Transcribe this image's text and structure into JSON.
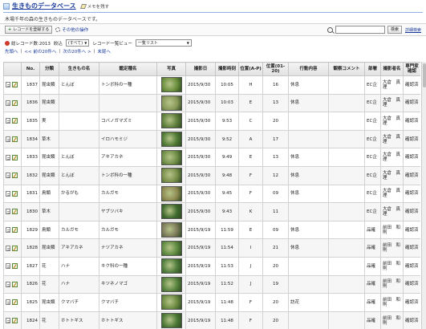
{
  "app": {
    "title": "生きものデータベース",
    "memo_label": "メモを残す"
  },
  "description": "木場千年の森の生きものデータベースです。",
  "toolbar": {
    "add_record_label": "レコードを登録する",
    "other_ops_label": "その他の操作",
    "search_placeholder": "",
    "search_button": "検索",
    "detail_search_label": "詳細検索"
  },
  "filters": {
    "total_label": "総レコード数:2013",
    "narrow_label": "絞込",
    "narrow_value": "(すべて)",
    "view_label": "レコード一覧ビュー",
    "view_value": "一覧リスト"
  },
  "pager": {
    "first": "先頭へ",
    "prev": "<< 前の20件へ",
    "next": "次の20件へ >",
    "last": "末尾へ"
  },
  "table": {
    "headers": [
      "No.",
      "分類",
      "生きもの名",
      "鑑定種名",
      "写真",
      "撮影日",
      "撮影時刻",
      "位置(A-P)",
      "位置(01-20)",
      "行動内容",
      "観察コメント",
      "部署",
      "撮影者名",
      "専門家確認"
    ],
    "rows": [
      {
        "no": "1837",
        "class": "昆虫類",
        "name": "とんぼ",
        "species": "トンボ科の一種",
        "photo": "#6a8f3c",
        "date": "2015/9/30",
        "time": "10:05",
        "pos_ap": "H",
        "pos_num": "16",
        "action": "休息",
        "comment": "",
        "dept": "EC企",
        "photographer": "大倉　真理",
        "expert": "確認済"
      },
      {
        "no": "1836",
        "class": "昆虫類",
        "name": "",
        "species": "",
        "photo": "#8a9a5a",
        "date": "2015/9/30",
        "time": "10:03",
        "pos_ap": "E",
        "pos_num": "13",
        "action": "休息",
        "comment": "",
        "dept": "EC企",
        "photographer": "大倉　真理",
        "expert": "確認済"
      },
      {
        "no": "1835",
        "class": "実",
        "name": "",
        "species": "コバノガマズミ",
        "photo": "#5e7f3a",
        "date": "2015/9/30",
        "time": "9:53",
        "pos_ap": "C",
        "pos_num": "20",
        "action": "",
        "comment": "",
        "dept": "EC企",
        "photographer": "大倉　真理",
        "expert": "確認済"
      },
      {
        "no": "1834",
        "class": "草木",
        "name": "",
        "species": "イロハモミジ",
        "photo": "#4f7a34",
        "date": "2015/9/30",
        "time": "9:52",
        "pos_ap": "A",
        "pos_num": "17",
        "action": "",
        "comment": "",
        "dept": "EC企",
        "photographer": "大倉　真理",
        "expert": "確認済"
      },
      {
        "no": "1833",
        "class": "昆虫類",
        "name": "とんぼ",
        "species": "アキアカネ",
        "photo": "#6d8d45",
        "date": "2015/9/30",
        "time": "9:49",
        "pos_ap": "E",
        "pos_num": "13",
        "action": "休息",
        "comment": "",
        "dept": "EC企",
        "photographer": "大倉　真理",
        "expert": "確認済"
      },
      {
        "no": "1832",
        "class": "昆虫類",
        "name": "とんぼ",
        "species": "トンボ科の一種",
        "photo": "#7a8f4a",
        "date": "2015/9/30",
        "time": "9:48",
        "pos_ap": "F",
        "pos_num": "12",
        "action": "休息",
        "comment": "",
        "dept": "EC企",
        "photographer": "大倉　真理",
        "expert": "確認済"
      },
      {
        "no": "1831",
        "class": "鳥類",
        "name": "かるがも",
        "species": "カルガモ",
        "photo": "#8f8a52",
        "date": "2015/9/30",
        "time": "9:45",
        "pos_ap": "F",
        "pos_num": "09",
        "action": "休息",
        "comment": "",
        "dept": "EC企",
        "photographer": "大倉　真理",
        "expert": "確認済"
      },
      {
        "no": "1830",
        "class": "草木",
        "name": "",
        "species": "ヤブツバキ",
        "photo": "#3f6a2e",
        "date": "2015/9/30",
        "time": "9:43",
        "pos_ap": "K",
        "pos_num": "11",
        "action": "",
        "comment": "",
        "dept": "EC企",
        "photographer": "大倉　真理",
        "expert": "確認済"
      },
      {
        "no": "1829",
        "class": "鳥類",
        "name": "カルガモ",
        "species": "カルガモ",
        "photo": "#7c7a5a",
        "date": "2015/9/19",
        "time": "11:59",
        "pos_ap": "E",
        "pos_num": "09",
        "action": "休息",
        "comment": "",
        "dept": "品確",
        "photographer": "前田　和則",
        "expert": "確認済"
      },
      {
        "no": "1828",
        "class": "昆虫類",
        "name": "アキアカネ",
        "species": "ナツアカネ",
        "photo": "#5d8a3f",
        "date": "2015/9/19",
        "time": "11:54",
        "pos_ap": "I",
        "pos_num": "21",
        "action": "休息",
        "comment": "",
        "dept": "品確",
        "photographer": "前田　和則",
        "expert": "確認済"
      },
      {
        "no": "1827",
        "class": "花",
        "name": "ハナ",
        "species": "キク科の一種",
        "photo": "#4e7d3b",
        "date": "2015/9/19",
        "time": "11:53",
        "pos_ap": "J",
        "pos_num": "20",
        "action": "",
        "comment": "",
        "dept": "品確",
        "photographer": "前田　和則",
        "expert": "確認済"
      },
      {
        "no": "1826",
        "class": "花",
        "name": "ハナ",
        "species": "キツネノマゴ",
        "photo": "#58843e",
        "date": "2015/9/19",
        "time": "11:52",
        "pos_ap": "J",
        "pos_num": "19",
        "action": "",
        "comment": "",
        "dept": "品確",
        "photographer": "前田　和則",
        "expert": "確認済"
      },
      {
        "no": "1825",
        "class": "昆虫類",
        "name": "クマバチ",
        "species": "クマバチ",
        "photo": "#6b8a40",
        "date": "2015/9/19",
        "time": "11:48",
        "pos_ap": "F",
        "pos_num": "20",
        "action": "訪花",
        "comment": "",
        "dept": "品確",
        "photographer": "前田　和則",
        "expert": "確認済"
      },
      {
        "no": "1824",
        "class": "花",
        "name": "ホトトギス",
        "species": "ホトトギス",
        "photo": "#4a7834",
        "date": "2015/9/19",
        "time": "11:48",
        "pos_ap": "F",
        "pos_num": "20",
        "action": "",
        "comment": "",
        "dept": "品確",
        "photographer": "前田　和則",
        "expert": "確認済"
      }
    ]
  }
}
